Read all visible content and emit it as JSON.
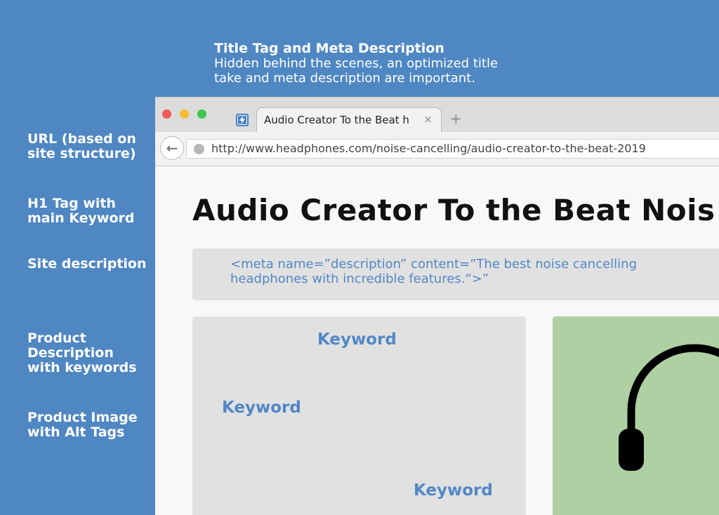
{
  "top_note": {
    "title": "Title Tag and Meta Description",
    "description_line1": "Hidden behind the scenes, an optimized title",
    "description_line2": "take and meta description are important."
  },
  "labels": {
    "url": "URL (based on\nsite structure)",
    "h1": "H1 Tag with\nmain Keyword",
    "site_description": "Site description",
    "product_description": "Product\nDescription\nwith keywords",
    "product_image": "Product Image\nwith Alt Tags"
  },
  "browser": {
    "tab": {
      "title": "Audio Creator To the Beat h",
      "close": "×"
    },
    "new_tab": "+",
    "back": "←",
    "url": "http://www.headphones.com/noise-cancelling/audio-creator-to-the-beat-2019"
  },
  "page": {
    "h1": "Audio Creator To the Beat Nois",
    "meta_line1": "<meta name=”description” content=”The best noise cancelling",
    "meta_line2": "headphones with incredible features.“>”",
    "keywords": [
      "Keyword",
      "Keyword",
      "Keyword"
    ]
  },
  "colors": {
    "background": "#4f87c2",
    "accent_text": "#5287c6",
    "panel": "#e1e1e1",
    "image_panel": "#aed0a3"
  },
  "icons": {
    "favicon": "lightning-icon",
    "globe": "globe-icon",
    "product": "headphones-icon"
  }
}
